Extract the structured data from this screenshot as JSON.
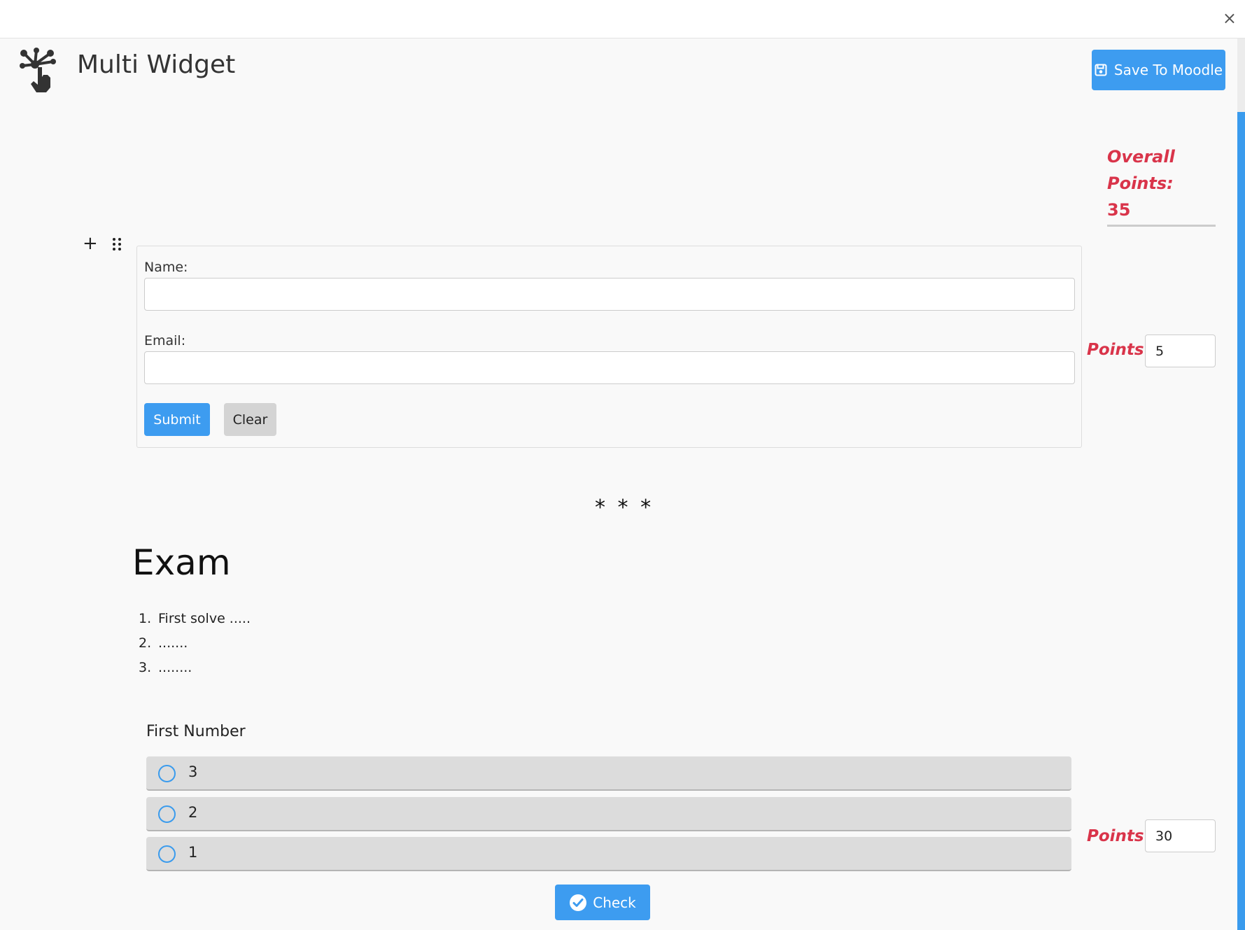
{
  "window": {
    "close_glyph": "×"
  },
  "header": {
    "title": "Multi Widget",
    "logo_icon": "network-hand-icon",
    "save_label": "Save To Moodle",
    "save_icon": "floppy-disk-icon"
  },
  "overall_points": {
    "label": "Overall Points:",
    "value": "35"
  },
  "form_widget": {
    "name_label": "Name:",
    "email_label": "Email:",
    "submit_label": "Submit",
    "clear_label": "Clear",
    "points_label": "Points",
    "points_value": "5"
  },
  "separator": "* * *",
  "exam": {
    "heading": "Exam",
    "items": [
      {
        "num": "1.",
        "text": "First solve ....."
      },
      {
        "num": "2.",
        "text": "......."
      },
      {
        "num": "3.",
        "text": "........"
      }
    ]
  },
  "quiz": {
    "question": "First Number",
    "options": [
      "3",
      "2",
      "1"
    ],
    "check_label": "Check",
    "points_label": "Points",
    "points_value": "30"
  },
  "colors": {
    "accent": "#3d9cf0",
    "points_red": "#d9344a",
    "option_bg": "#dcdcdc"
  }
}
